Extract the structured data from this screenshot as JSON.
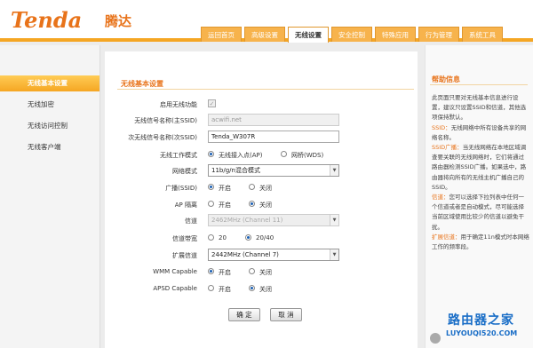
{
  "header": {
    "logo": "Tenda",
    "logo_cn": "腾达",
    "tabs": [
      {
        "label": "运回首页"
      },
      {
        "label": "高级设置"
      },
      {
        "label": "无线设置",
        "active": true
      },
      {
        "label": "安全控制"
      },
      {
        "label": "特殊应用"
      },
      {
        "label": "行为管理"
      },
      {
        "label": "系统工具"
      }
    ],
    "accent_color": "#f5a623"
  },
  "sidebar": {
    "items": [
      {
        "label": "无线基本设置",
        "active": true
      },
      {
        "label": "无线加密"
      },
      {
        "label": "无线访问控制"
      },
      {
        "label": "无线客户端"
      }
    ]
  },
  "form": {
    "title": "无线基本设置",
    "enable_wireless": {
      "label": "启用无线功能",
      "checked": true
    },
    "ssid_primary": {
      "label": "无线信号名称(主SSID)",
      "value": "acwifi.net"
    },
    "ssid_secondary": {
      "label": "次无线信号名称(次SSID)",
      "value": "Tenda_W307R"
    },
    "work_mode": {
      "label": "无线工作模式",
      "option_ap": "无线接入点(AP)",
      "option_bridge": "网桥(WDS)",
      "selected": "ap"
    },
    "network_mode": {
      "label": "网络模式",
      "value": "11b/g/n混合模式"
    },
    "broadcast": {
      "label": "广播(SSID)",
      "on": "开启",
      "off": "关闭",
      "selected": "on"
    },
    "ap_isolation": {
      "label": "AP 隔离",
      "on": "开启",
      "off": "关闭",
      "selected": "off"
    },
    "channel": {
      "label": "信道",
      "value": "2462MHz (Channel 11)"
    },
    "bandwidth": {
      "label": "信道带宽",
      "opt1": "20",
      "opt2": "20/40",
      "selected": "20/40"
    },
    "ext_channel": {
      "label": "扩展信道",
      "value": "2442MHz (Channel 7)"
    },
    "wmm": {
      "label": "WMM Capable",
      "on": "开启",
      "off": "关闭",
      "selected": "on"
    },
    "apsd": {
      "label": "APSD Capable",
      "on": "开启",
      "off": "关闭",
      "selected": "off"
    },
    "ok_label": "确 定",
    "cancel_label": "取 消"
  },
  "help": {
    "title": "帮助信息",
    "p1": "此页面只要对无线基本信息进行设置，建议只设置SSID和信道，其他选项保持默认。",
    "ssid_key": "SSID：",
    "ssid_text": "无线网络中所有设备共享的网络名称。",
    "bc_key": "SSID广播：",
    "bc_text": "当无线网络在本地区域调查要关联的无线网络时，它们将通过路由器检测SSID广播。如果选中，路由器将向所有的无线主机广播自己的SSID。",
    "ch_key": "信道：",
    "ch_text": "您可以选择下拉列表中任何一个信道或者是自动模式，尽可能选择当前区域使用比较少的信道以避免干扰。",
    "ext_key": "扩展信道：",
    "ext_text": "用于确定11n模式时本网络工作的频率段。"
  },
  "watermark": {
    "cn": "路由器之家",
    "url": "LUYOUQI520.COM"
  }
}
